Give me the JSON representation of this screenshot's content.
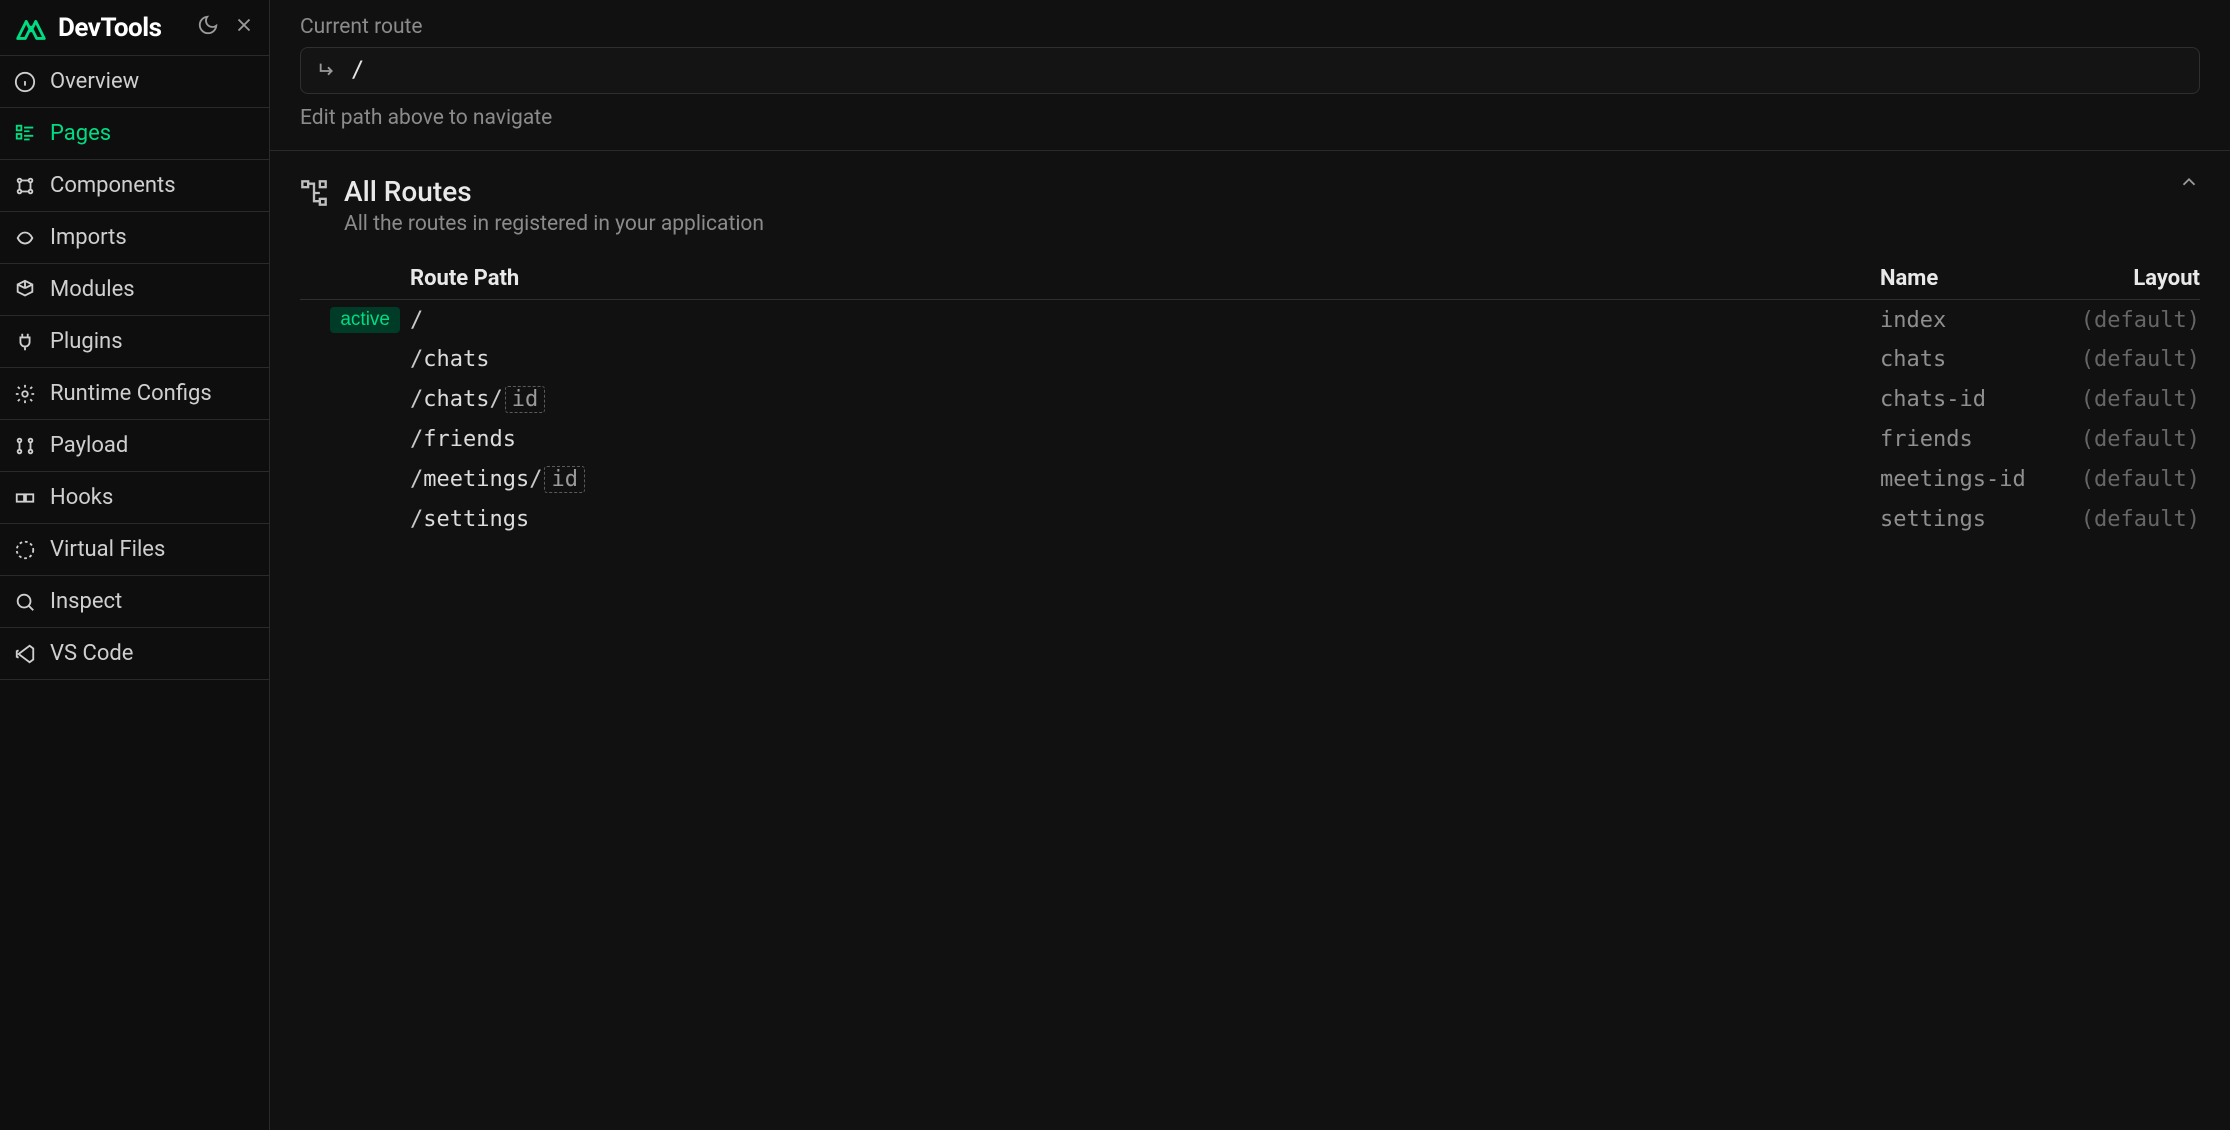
{
  "app": {
    "title": "DevTools"
  },
  "sidebar": {
    "items": [
      {
        "id": "overview",
        "label": "Overview",
        "icon": "info-icon"
      },
      {
        "id": "pages",
        "label": "Pages",
        "icon": "pages-icon",
        "active": true
      },
      {
        "id": "components",
        "label": "Components",
        "icon": "components-icon"
      },
      {
        "id": "imports",
        "label": "Imports",
        "icon": "imports-icon"
      },
      {
        "id": "modules",
        "label": "Modules",
        "icon": "modules-icon"
      },
      {
        "id": "plugins",
        "label": "Plugins",
        "icon": "plugins-icon"
      },
      {
        "id": "runtime-configs",
        "label": "Runtime Configs",
        "icon": "configs-icon"
      },
      {
        "id": "payload",
        "label": "Payload",
        "icon": "payload-icon"
      },
      {
        "id": "hooks",
        "label": "Hooks",
        "icon": "hooks-icon"
      },
      {
        "id": "virtual-files",
        "label": "Virtual Files",
        "icon": "virtual-files-icon"
      },
      {
        "id": "inspect",
        "label": "Inspect",
        "icon": "inspect-icon"
      },
      {
        "id": "vscode",
        "label": "VS Code",
        "icon": "vscode-icon"
      }
    ]
  },
  "currentRoute": {
    "label": "Current route",
    "value": "/",
    "hint": "Edit path above to navigate"
  },
  "routes": {
    "title": "All Routes",
    "subtitle": "All the routes in registered in your application",
    "columns": {
      "path": "Route Path",
      "name": "Name",
      "layout": "Layout"
    },
    "activeBadge": "active",
    "rows": [
      {
        "active": true,
        "segments": [
          {
            "t": "slash"
          }
        ],
        "name": "index",
        "layout": "(default)"
      },
      {
        "active": false,
        "segments": [
          {
            "t": "slash"
          },
          {
            "t": "text",
            "v": "chats"
          }
        ],
        "name": "chats",
        "layout": "(default)"
      },
      {
        "active": false,
        "segments": [
          {
            "t": "slash"
          },
          {
            "t": "text",
            "v": "chats"
          },
          {
            "t": "slash"
          },
          {
            "t": "param",
            "v": "id"
          }
        ],
        "name": "chats-id",
        "layout": "(default)"
      },
      {
        "active": false,
        "segments": [
          {
            "t": "slash"
          },
          {
            "t": "text",
            "v": "friends"
          }
        ],
        "name": "friends",
        "layout": "(default)"
      },
      {
        "active": false,
        "segments": [
          {
            "t": "slash"
          },
          {
            "t": "text",
            "v": "meetings"
          },
          {
            "t": "slash"
          },
          {
            "t": "param",
            "v": "id"
          }
        ],
        "name": "meetings-id",
        "layout": "(default)"
      },
      {
        "active": false,
        "segments": [
          {
            "t": "slash"
          },
          {
            "t": "text",
            "v": "settings"
          }
        ],
        "name": "settings",
        "layout": "(default)"
      }
    ]
  }
}
